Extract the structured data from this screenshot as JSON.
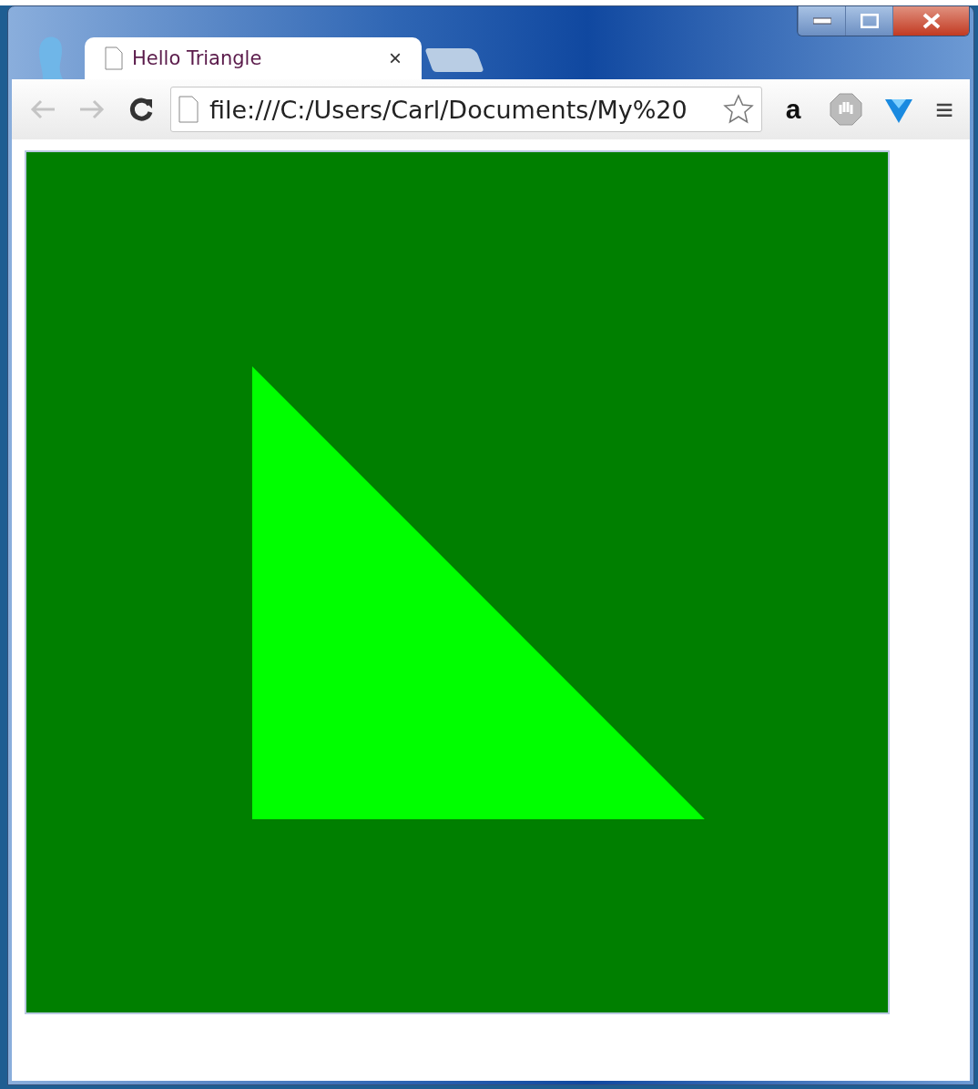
{
  "tabs": [
    {
      "title": "Hello Triangle",
      "close": "×",
      "selected": true
    }
  ],
  "address": {
    "value": "file:///C:/Users/Carl/Documents/My%20",
    "starred": false
  },
  "extensions": [
    {
      "kind": "letter",
      "label": "a"
    },
    {
      "kind": "hand"
    },
    {
      "kind": "gem"
    }
  ],
  "menu": "≡"
}
